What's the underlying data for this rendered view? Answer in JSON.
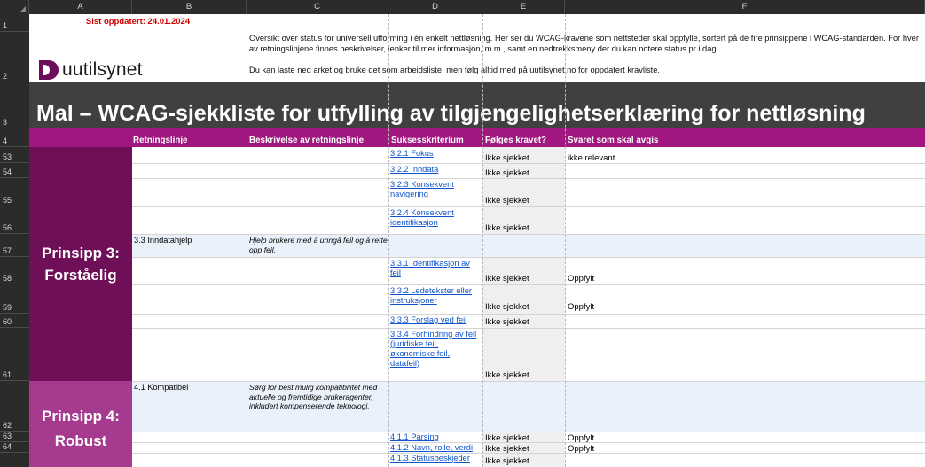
{
  "columns": [
    "A",
    "B",
    "C",
    "D",
    "E",
    "F"
  ],
  "rows": [
    "1",
    "2",
    "3",
    "4",
    "53",
    "54",
    "55",
    "56",
    "57",
    "58",
    "59",
    "60",
    "61",
    "62",
    "63",
    "64"
  ],
  "sheet": {
    "updated": "Sist oppdatert: 24.01.2024",
    "logo_text": "uutilsynet",
    "intro_1": "Oversikt over status for universell utforming i én enkelt nettløsning. Her ser du WCAG-kravene som nettsteder skal oppfylle, sortert på de fire prinsippene i WCAG-standarden. For hver av retningslinjene finnes beskrivelser, lenker til mer informasjon, m.m., samt en nedtrekksmeny der du kan notere status pr i dag.",
    "intro_2": "Du kan laste ned arket og bruke det som arbeidsliste, men følg alltid med på uutilsynet.no for oppdatert kravliste.",
    "title": "Mal – WCAG-sjekkliste for utfylling av tilgjengelighetserklæring for nettløsning"
  },
  "headers": {
    "guideline": "Retningslinje",
    "description": "Beskrivelse av retningslinje",
    "criterion": "Suksesskriterium",
    "followed": "Følges kravet?",
    "answer": "Svaret som skal avgis"
  },
  "principles": {
    "p3_line1": "Prinsipp 3:",
    "p3_line2": "Forståelig",
    "p4_line1": "Prinsipp 4:",
    "p4_line2": "Robust"
  },
  "table": {
    "r53": {
      "criterion": "3.2.1 Fokus",
      "status": "Ikke sjekket",
      "answer": "ikke relevant"
    },
    "r54": {
      "criterion": "3.2.2 Inndata",
      "status": "Ikke sjekket"
    },
    "r55": {
      "criterion": "3.2.3 Konsekvent navigering",
      "status": "Ikke sjekket"
    },
    "r56": {
      "criterion": "3.2.4 Konsekvent identifikasjon",
      "status": "Ikke sjekket"
    },
    "r57": {
      "guideline": "3.3 Inndatahjelp",
      "description": "Hjelp brukere med å unngå feil og å rette opp feil."
    },
    "r58": {
      "criterion": "3.3.1 Identifikasjon av feil",
      "status": "Ikke sjekket",
      "answer": "Oppfylt"
    },
    "r59": {
      "criterion": "3.3.2 Ledetekster eller instruksjoner",
      "status": "Ikke sjekket",
      "answer": "Oppfylt"
    },
    "r60": {
      "criterion": "3.3.3 Forslag ved feil",
      "status": "Ikke sjekket"
    },
    "r61": {
      "criterion": "3.3.4 Forhindring av feil (juridiske feil, økonomiske feil, datafeil)",
      "status": "Ikke sjekket"
    },
    "r62": {
      "guideline": "4.1 Kompatibel",
      "description": "Sørg for best mulig kompatibilitet med aktuelle og fremtidige brukeragenter, inkludert kompenserende teknologi."
    },
    "r63": {
      "criterion": "4.1.1 Parsing",
      "status": "Ikke sjekket",
      "answer": "Oppfylt"
    },
    "r64": {
      "criterion": "4.1.2 Navn, rolle, verdi",
      "status": "Ikke sjekket",
      "answer": "Oppfylt"
    },
    "r65": {
      "criterion": "4.1.3 Statusbeskjeder",
      "status": "Ikke sjekket"
    }
  },
  "colors": {
    "principle3": "#6e0f58",
    "principle4": "#a53a8f",
    "header_row": "#a0177f",
    "title_bg": "#404040",
    "updated_text": "#d10000",
    "link": "#1155cc"
  }
}
